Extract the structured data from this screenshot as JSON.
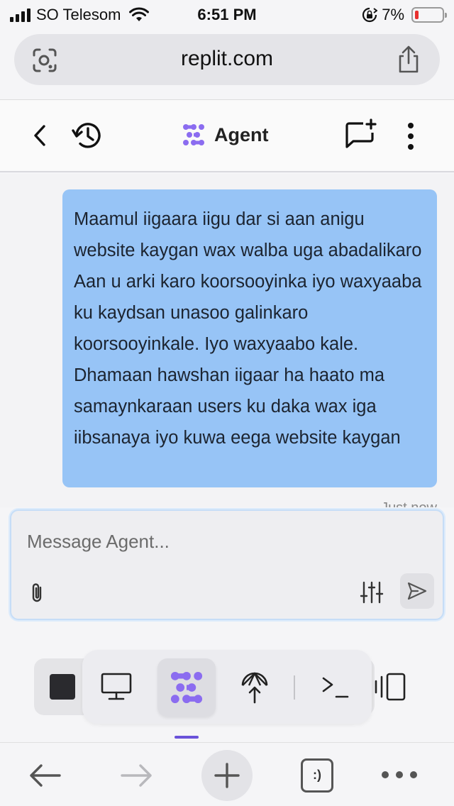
{
  "status_bar": {
    "carrier": "SO Telesom",
    "time": "6:51 PM",
    "battery_percent": "7%",
    "battery_level": 0.07,
    "battery_color": "#e8302f"
  },
  "browser": {
    "url": "replit.com",
    "icons": {
      "left": "search-lens-icon",
      "share": "share-icon"
    }
  },
  "header": {
    "title": "Agent",
    "icons": [
      "back-chevron-icon",
      "history-icon",
      "agent-logo-icon",
      "new-chat-icon",
      "more-vertical-icon"
    ]
  },
  "chat": {
    "messages": [
      {
        "role": "user",
        "text": "Maamul iigaara iigu dar si aan anigu website kaygan wax walba uga abadalikaro Aan u arki karo koorsooyinka iyo waxyaaba ku kaydsan unasoo galinkaro koorsooyinkale. Iyo waxyaabo kale. Dhamaan hawshan iigaar ha haato ma samaynkaraan users ku daka wax iga iibsanaya iyo kuwa eega website kaygan",
        "timestamp": "Just now"
      }
    ],
    "bubble_color": "#97c4f6"
  },
  "composer": {
    "placeholder": "Message Agent...",
    "value": "",
    "icons": [
      "paperclip-icon",
      "sliders-icon",
      "send-icon"
    ]
  },
  "dock": {
    "tools": [
      "stop-icon",
      "preview-monitor-icon",
      "agent-icon",
      "deployments-icon",
      "shell-icon",
      "panels-icon"
    ],
    "active_tool": "agent-icon",
    "accent": "#8b6cf0"
  },
  "browser_toolbar": {
    "tabs_label": ":)",
    "icons": [
      "back-arrow-icon",
      "forward-arrow-icon",
      "new-tab-plus-icon",
      "tabs-icon",
      "more-dots-icon"
    ]
  }
}
